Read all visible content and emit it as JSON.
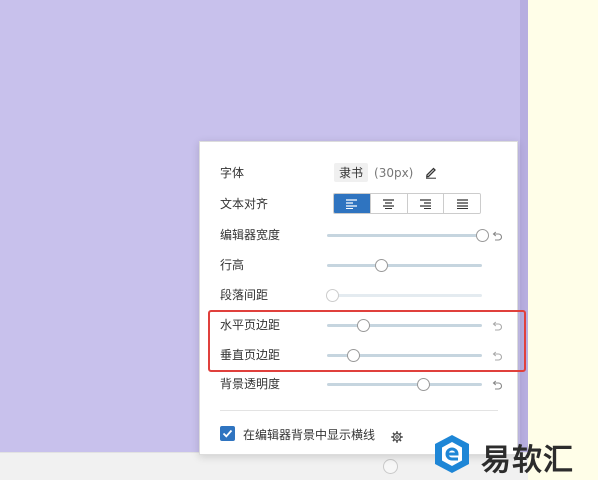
{
  "settings": {
    "font": {
      "label": "字体",
      "name": "隶书",
      "size": "(30px)"
    },
    "text_align": {
      "label": "文本对齐",
      "options": [
        "left",
        "center",
        "right",
        "justify"
      ],
      "selected": "left"
    },
    "sliders": [
      {
        "key": "editor-width",
        "label": "编辑器宽度",
        "value": 1.0,
        "disabled": false
      },
      {
        "key": "line-height",
        "label": "行高",
        "value": 0.35,
        "disabled": false
      },
      {
        "key": "paragraph-spacing",
        "label": "段落间距",
        "value": 0.03,
        "disabled": true
      },
      {
        "key": "horizontal-margin",
        "label": "水平页边距",
        "value": 0.23,
        "disabled": false
      },
      {
        "key": "vertical-margin",
        "label": "垂直页边距",
        "value": 0.17,
        "disabled": false
      },
      {
        "key": "background-opacity",
        "label": "背景透明度",
        "value": 0.62,
        "disabled": false
      }
    ],
    "show_lines": {
      "label": "在编辑器背景中显示横线",
      "checked": true
    }
  },
  "colors": {
    "canvas": "#c8c1ec",
    "accent": "#2f74c0",
    "highlight": "#e0403c",
    "right_panel": "#fffee8"
  },
  "icons": {
    "edit": "pencil-icon",
    "reset": "undo-icon",
    "settings": "gear-icon"
  },
  "watermark": {
    "text": "易软汇"
  }
}
